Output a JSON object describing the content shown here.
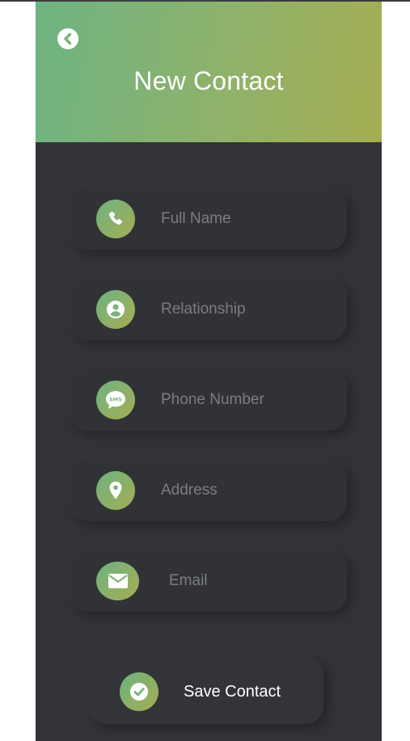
{
  "header": {
    "title": "New Contact",
    "back_icon": "chevron-left-circle-icon"
  },
  "fields": [
    {
      "placeholder": "Full Name",
      "icon": "phone-icon"
    },
    {
      "placeholder": "Relationship",
      "icon": "user-circle-icon"
    },
    {
      "placeholder": "Phone Number",
      "icon": "sms-icon"
    },
    {
      "placeholder": "Address",
      "icon": "location-pin-icon"
    },
    {
      "placeholder": "Email",
      "icon": "envelope-icon"
    }
  ],
  "save": {
    "label": "Save Contact",
    "icon": "check-circle-icon"
  },
  "colors": {
    "gradient_start": "#6db382",
    "gradient_end": "#a5ad52",
    "panel_background": "#323438",
    "placeholder_text": "#7b7d80"
  }
}
